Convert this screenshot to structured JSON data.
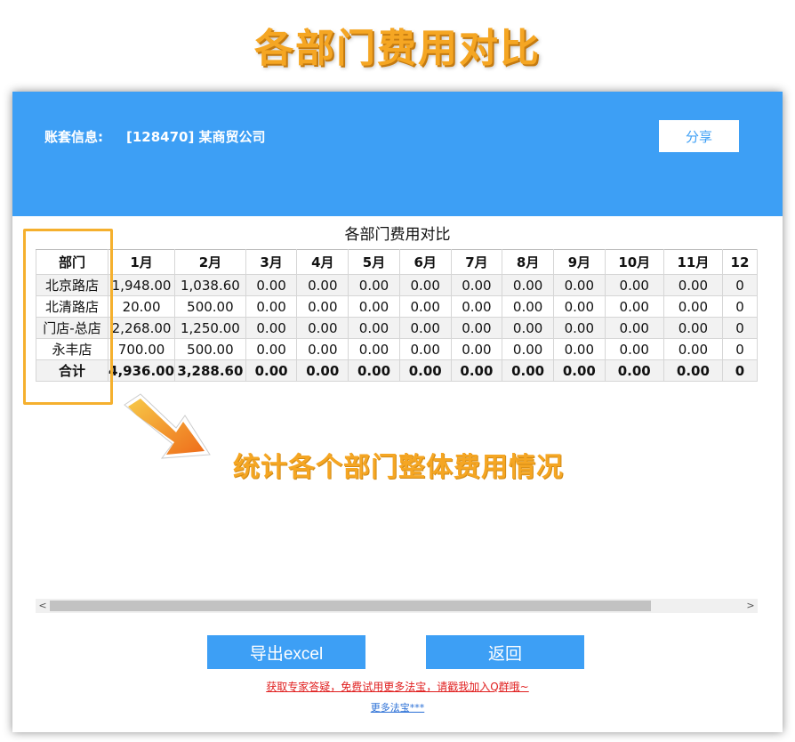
{
  "banner": {
    "title": "各部门费用对比"
  },
  "header": {
    "account_label": "账套信息:",
    "account_value": "[128470] 某商贸公司",
    "share_label": "分享"
  },
  "report": {
    "title": "各部门费用对比",
    "columns": [
      "部门",
      "1月",
      "2月",
      "3月",
      "4月",
      "5月",
      "6月",
      "7月",
      "8月",
      "9月",
      "10月",
      "11月",
      "12"
    ],
    "rows": [
      [
        "北京路店",
        "1,948.00",
        "1,038.60",
        "0.00",
        "0.00",
        "0.00",
        "0.00",
        "0.00",
        "0.00",
        "0.00",
        "0.00",
        "0.00",
        "0"
      ],
      [
        "北清路店",
        "20.00",
        "500.00",
        "0.00",
        "0.00",
        "0.00",
        "0.00",
        "0.00",
        "0.00",
        "0.00",
        "0.00",
        "0.00",
        "0"
      ],
      [
        "门店-总店",
        "2,268.00",
        "1,250.00",
        "0.00",
        "0.00",
        "0.00",
        "0.00",
        "0.00",
        "0.00",
        "0.00",
        "0.00",
        "0.00",
        "0"
      ],
      [
        "永丰店",
        "700.00",
        "500.00",
        "0.00",
        "0.00",
        "0.00",
        "0.00",
        "0.00",
        "0.00",
        "0.00",
        "0.00",
        "0.00",
        "0"
      ]
    ],
    "total_row": [
      "合计",
      "4,936.00",
      "3,288.60",
      "0.00",
      "0.00",
      "0.00",
      "0.00",
      "0.00",
      "0.00",
      "0.00",
      "0.00",
      "0.00",
      "0"
    ]
  },
  "annotation": {
    "text": "统计各个部门整体费用情况"
  },
  "scrollbar": {
    "left_arrow": "<",
    "right_arrow": ">"
  },
  "actions": {
    "export_label": "导出excel",
    "back_label": "返回"
  },
  "footer": {
    "promo_link": "获取专家答疑，免费试用更多法宝，请戳我加入Q群哦~",
    "more_link": "更多法宝***"
  },
  "colors": {
    "accent": "#3d9ff5",
    "highlight": "#f5a623",
    "promo": "#e02020"
  }
}
